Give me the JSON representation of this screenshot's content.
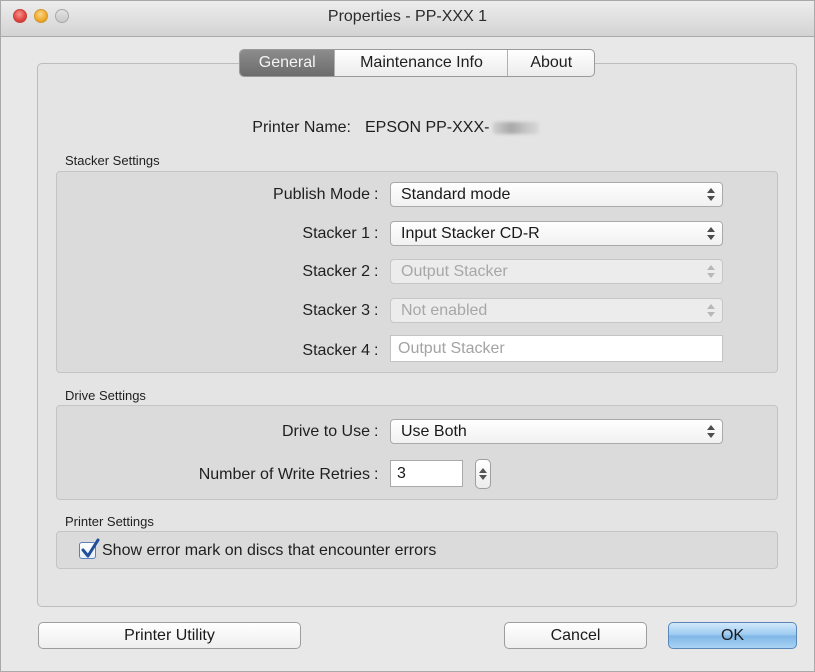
{
  "window": {
    "title": "Properties - PP-XXX 1"
  },
  "tabs": [
    {
      "label": "General",
      "active": true
    },
    {
      "label": "Maintenance Info",
      "active": false
    },
    {
      "label": "About",
      "active": false
    }
  ],
  "printer": {
    "label": "Printer Name:",
    "value": "EPSON PP-XXX-"
  },
  "stacker_settings": {
    "title": "Stacker Settings",
    "publish_mode": {
      "label": "Publish Mode",
      "value": "Standard mode",
      "enabled": true
    },
    "stacker1": {
      "label": "Stacker 1",
      "value": "Input Stacker CD-R",
      "enabled": true
    },
    "stacker2": {
      "label": "Stacker 2",
      "value": "Output Stacker",
      "enabled": false
    },
    "stacker3": {
      "label": "Stacker 3",
      "value": "Not enabled",
      "enabled": false
    },
    "stacker4": {
      "label": "Stacker 4",
      "value": "Output Stacker",
      "enabled": false
    }
  },
  "drive_settings": {
    "title": "Drive Settings",
    "drive_to_use": {
      "label": "Drive to Use",
      "value": "Use Both"
    },
    "write_retries": {
      "label": "Number of Write Retries",
      "value": "3"
    }
  },
  "printer_settings": {
    "title": "Printer Settings",
    "error_mark": {
      "label": "Show error mark on discs that encounter errors",
      "checked": true
    }
  },
  "buttons": {
    "printer_utility": "Printer Utility",
    "cancel": "Cancel",
    "ok": "OK"
  },
  "colon": ":",
  "colors": {
    "default_button": "#98c8ef",
    "active_tab": "#7a7a7a",
    "checkmark": "#1f4f9a"
  }
}
